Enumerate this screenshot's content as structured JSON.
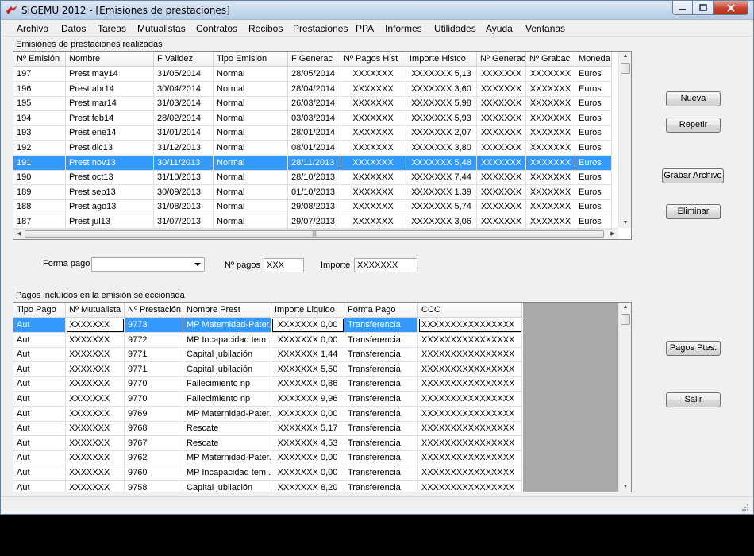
{
  "window": {
    "title": "SIGEMU 2012 - [Emisiones de prestaciones]"
  },
  "menu": [
    "Archivo",
    "Datos",
    "Tareas",
    "Mutualistas",
    "Contratos",
    "Recibos",
    "Prestaciones",
    "PPA",
    "Informes",
    "Utilidades",
    "Ayuda",
    "Ventanas"
  ],
  "emisiones": {
    "label": "Emisiones de prestaciones realizadas",
    "columns": [
      "Nº Emisión",
      "Nombre",
      "F Validez",
      "Tipo Emisión",
      "F Generac",
      "Nº Pagos Hist",
      "Importe Histco.",
      "Nº Generac",
      "Nº Grabac",
      "Moneda"
    ],
    "rows": [
      [
        "197",
        "Prest may14",
        "31/05/2014",
        "Normal",
        "28/05/2014",
        "XXXXXXX",
        "XXXXXXX 5,13",
        "XXXXXXX",
        "XXXXXXX",
        "Euros"
      ],
      [
        "196",
        "Prest abr14",
        "30/04/2014",
        "Normal",
        "28/04/2014",
        "XXXXXXX",
        "XXXXXXX 3,60",
        "XXXXXXX",
        "XXXXXXX",
        "Euros"
      ],
      [
        "195",
        "Prest mar14",
        "31/03/2014",
        "Normal",
        "26/03/2014",
        "XXXXXXX",
        "XXXXXXX 5,98",
        "XXXXXXX",
        "XXXXXXX",
        "Euros"
      ],
      [
        "194",
        "Prest feb14",
        "28/02/2014",
        "Normal",
        "03/03/2014",
        "XXXXXXX",
        "XXXXXXX 5,93",
        "XXXXXXX",
        "XXXXXXX",
        "Euros"
      ],
      [
        "193",
        "Prest ene14",
        "31/01/2014",
        "Normal",
        "28/01/2014",
        "XXXXXXX",
        "XXXXXXX 2,07",
        "XXXXXXX",
        "XXXXXXX",
        "Euros"
      ],
      [
        "192",
        "Prest dic13",
        "31/12/2013",
        "Normal",
        "08/01/2014",
        "XXXXXXX",
        "XXXXXXX 3,80",
        "XXXXXXX",
        "XXXXXXX",
        "Euros"
      ],
      [
        "191",
        "Prest nov13",
        "30/11/2013",
        "Normal",
        "28/11/2013",
        "XXXXXXX",
        "XXXXXXX 5,48",
        "XXXXXXX",
        "XXXXXXX",
        "Euros"
      ],
      [
        "190",
        "Prest oct13",
        "31/10/2013",
        "Normal",
        "28/10/2013",
        "XXXXXXX",
        "XXXXXXX 7,44",
        "XXXXXXX",
        "XXXXXXX",
        "Euros"
      ],
      [
        "189",
        "Prest sep13",
        "30/09/2013",
        "Normal",
        "01/10/2013",
        "XXXXXXX",
        "XXXXXXX 1,39",
        "XXXXXXX",
        "XXXXXXX",
        "Euros"
      ],
      [
        "188",
        "Prest ago13",
        "31/08/2013",
        "Normal",
        "29/08/2013",
        "XXXXXXX",
        "XXXXXXX 5,74",
        "XXXXXXX",
        "XXXXXXX",
        "Euros"
      ],
      [
        "187",
        "Prest jul13",
        "31/07/2013",
        "Normal",
        "29/07/2013",
        "XXXXXXX",
        "XXXXXXX 3,06",
        "XXXXXXX",
        "XXXXXXX",
        "Euros"
      ]
    ],
    "selected_row": 6
  },
  "filters": {
    "forma_pago_label": "Forma pago",
    "forma_pago_value": "",
    "num_pagos_label": "Nº pagos",
    "num_pagos_value": "XXX",
    "importe_label": "Importe",
    "importe_value": "XXXXXXX"
  },
  "pagos": {
    "label": "Pagos incluídos en la emisión seleccionada",
    "columns": [
      "Tipo Pago",
      "Nº Mutualista",
      "Nº Prestación",
      "Nombre Prest",
      "Importe Liquido",
      "Forma Pago",
      "CCC"
    ],
    "rows": [
      [
        "Aut",
        "XXXXXXX",
        "9773",
        "MP Maternidad-Pater...",
        "XXXXXXX 0,00",
        "Transferencia",
        "XXXXXXXXXXXXXXXX"
      ],
      [
        "Aut",
        "XXXXXXX",
        "9772",
        "MP Incapacidad tem...",
        "XXXXXXX 0,00",
        "Transferencia",
        "XXXXXXXXXXXXXXXX"
      ],
      [
        "Aut",
        "XXXXXXX",
        "9771",
        "Capital jubilación",
        "XXXXXXX 1,44",
        "Transferencia",
        "XXXXXXXXXXXXXXXX"
      ],
      [
        "Aut",
        "XXXXXXX",
        "9771",
        "Capital jubilación",
        "XXXXXXX 5,50",
        "Transferencia",
        "XXXXXXXXXXXXXXXX"
      ],
      [
        "Aut",
        "XXXXXXX",
        "9770",
        "Fallecimiento np",
        "XXXXXXX 0,86",
        "Transferencia",
        "XXXXXXXXXXXXXXXX"
      ],
      [
        "Aut",
        "XXXXXXX",
        "9770",
        "Fallecimiento np",
        "XXXXXXX 9,96",
        "Transferencia",
        "XXXXXXXXXXXXXXXX"
      ],
      [
        "Aut",
        "XXXXXXX",
        "9769",
        "MP Maternidad-Pater...",
        "XXXXXXX 0,00",
        "Transferencia",
        "XXXXXXXXXXXXXXXX"
      ],
      [
        "Aut",
        "XXXXXXX",
        "9768",
        "Rescate",
        "XXXXXXX 5,17",
        "Transferencia",
        "XXXXXXXXXXXXXXXX"
      ],
      [
        "Aut",
        "XXXXXXX",
        "9767",
        "Rescate",
        "XXXXXXX 4,53",
        "Transferencia",
        "XXXXXXXXXXXXXXXX"
      ],
      [
        "Aut",
        "XXXXXXX",
        "9762",
        "MP Maternidad-Pater...",
        "XXXXXXX 0,00",
        "Transferencia",
        "XXXXXXXXXXXXXXXX"
      ],
      [
        "Aut",
        "XXXXXXX",
        "9760",
        "MP Incapacidad tem...",
        "XXXXXXX 0,00",
        "Transferencia",
        "XXXXXXXXXXXXXXXX"
      ],
      [
        "Aut",
        "XXXXXXX",
        "9758",
        "Capital jubilación",
        "XXXXXXX 8,20",
        "Transferencia",
        "XXXXXXXXXXXXXXXX"
      ]
    ],
    "selected_row": 0
  },
  "buttons": {
    "nueva": "Nueva",
    "repetir": "Repetir",
    "grabar": "Grabar Archivo",
    "eliminar": "Eliminar",
    "pagos_ptes": "Pagos Ptes.",
    "salir": "Salir"
  },
  "colors": {
    "selection": "#3399ff",
    "grid_border": "#828790",
    "grey_area": "#aaaaaa"
  }
}
